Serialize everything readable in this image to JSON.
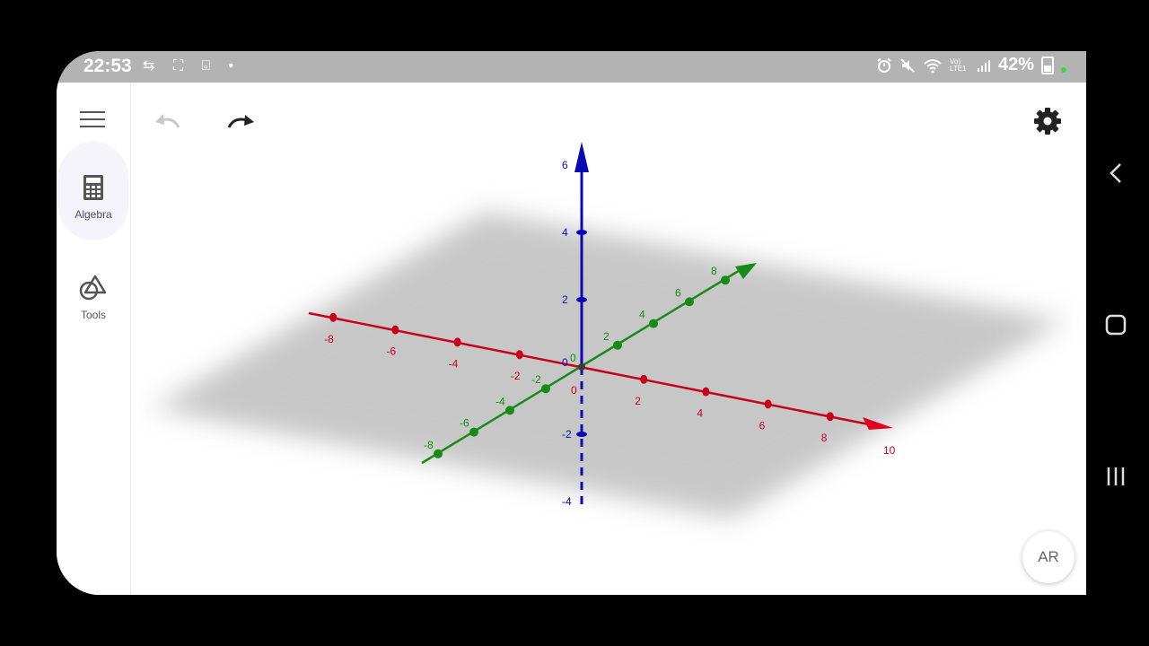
{
  "status_bar": {
    "time": "22:53",
    "left_icons": "⇆ ⛶ ⌻ •",
    "network_label": "Vo) LTE1",
    "battery_percent": "42%"
  },
  "sidebar": {
    "items": [
      {
        "label": "Algebra",
        "icon": "calculator-icon",
        "active": true
      },
      {
        "label": "Tools",
        "icon": "shapes-icon",
        "active": false
      }
    ]
  },
  "ar_button": {
    "label": "AR"
  },
  "colors": {
    "x_axis": "#c8001e",
    "y_axis": "#178a17",
    "z_axis": "#0a0ab4",
    "plane": "#c8c8c8",
    "status_bar": "#b3b3b3"
  },
  "axes": {
    "x": {
      "labels": [
        "-8",
        "-6",
        "-4",
        "-2",
        "2",
        "4",
        "6",
        "8",
        "10"
      ]
    },
    "y": {
      "labels": [
        "-8",
        "-6",
        "-4",
        "-2",
        "2",
        "4",
        "6",
        "8"
      ]
    },
    "z": {
      "labels": [
        "6",
        "4",
        "2",
        "-2",
        "-4"
      ]
    },
    "origin_labels": [
      "0",
      "0",
      "0"
    ]
  }
}
